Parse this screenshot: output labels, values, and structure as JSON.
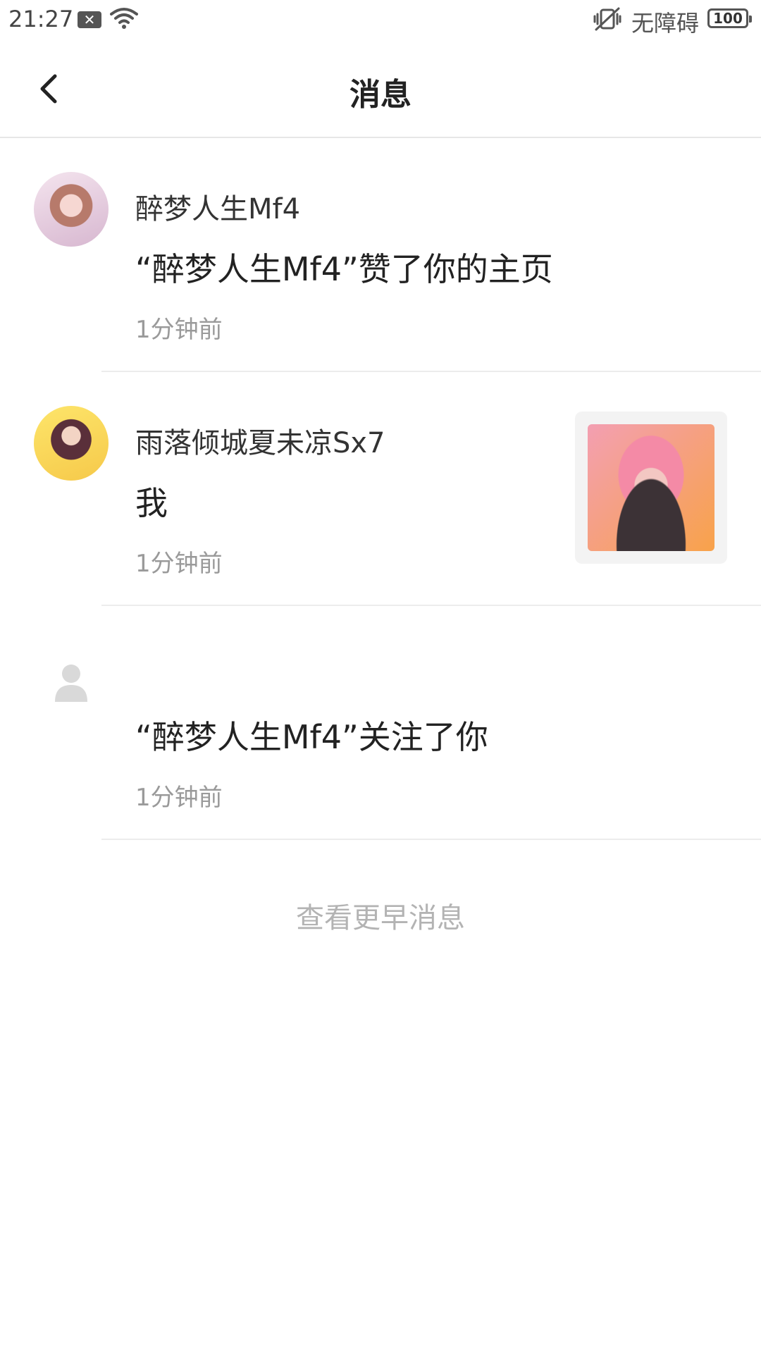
{
  "status_bar": {
    "time": "21:27",
    "notification_badge": "✕",
    "accessibility_label": "无障碍",
    "battery_level": "100"
  },
  "header": {
    "title": "消息"
  },
  "messages": [
    {
      "sender": "醉梦人生Mf4",
      "text": "“醉梦人生Mf4”赞了你的主页",
      "time": "1分钟前",
      "avatar": "anime-girl-avatar"
    },
    {
      "sender": "雨落倾城夏未凉Sx7",
      "text": "我",
      "time": "1分钟前",
      "avatar": "anime-girl-yellow-avatar",
      "thumbnail": "pink-hair-anime-thumbnail"
    },
    {
      "sender": "",
      "text": "“醉梦人生Mf4”关注了你",
      "time": "1分钟前",
      "avatar": "default-user-icon"
    }
  ],
  "load_more_label": "查看更早消息"
}
